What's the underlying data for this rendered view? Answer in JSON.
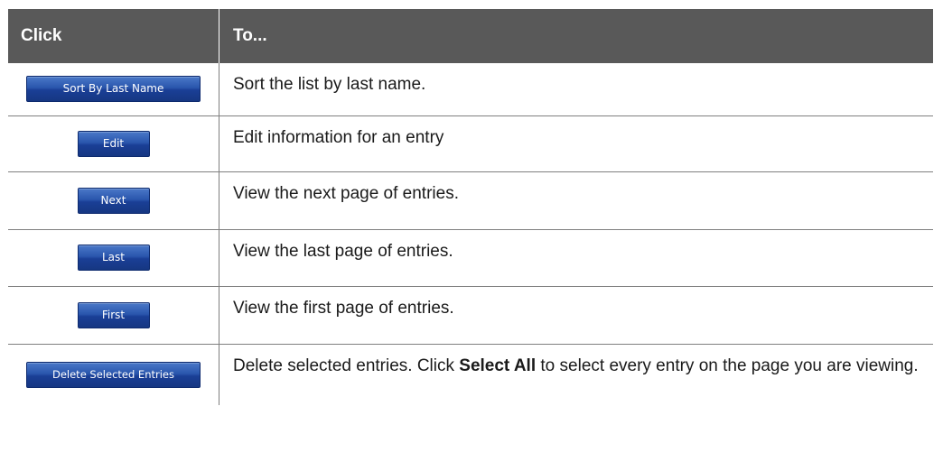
{
  "header": {
    "click": "Click",
    "to": "To..."
  },
  "rows": [
    {
      "button": "Sort By Last Name",
      "description": "Sort the list by last name."
    },
    {
      "button": "Edit",
      "description": "Edit information for an entry"
    },
    {
      "button": "Next",
      "description": "View the next page of entries."
    },
    {
      "button": "Last",
      "description": "View the last page of entries."
    },
    {
      "button": "First",
      "description": "View the first page of entries."
    },
    {
      "button": "Delete Selected Entries",
      "description_before": "Delete selected entries. Click ",
      "description_bold": "Select All",
      "description_after": " to select every entry on the page you are viewing."
    }
  ],
  "colors": {
    "header_bg": "#595959",
    "button_blue": "#1f4aa3"
  }
}
